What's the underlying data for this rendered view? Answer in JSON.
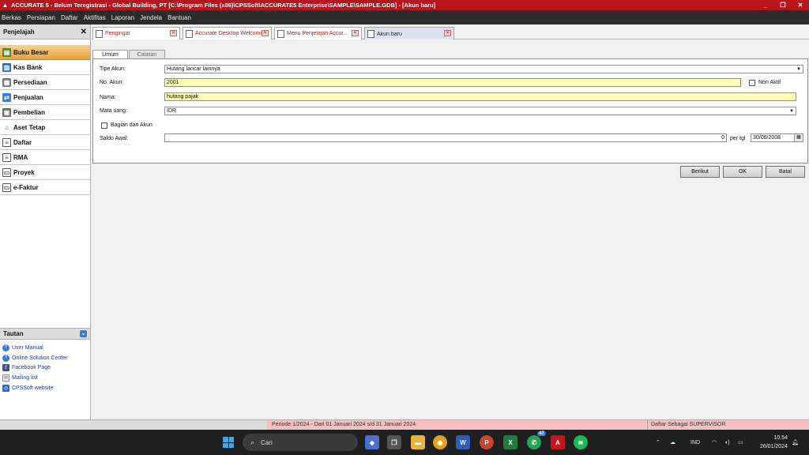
{
  "window": {
    "title": "ACCURATE 5 - Belum Teregistrasi - Global Building, PT   [C:\\Program Files (x86)\\CPSSoft\\ACCURATE5 Enterprise\\SAMPLE\\SAMPLE.GDB] - [Akun baru]",
    "controls": [
      "_",
      "❐",
      "✕"
    ]
  },
  "menu": [
    "Berkas",
    "Persiapan",
    "Daftar",
    "Aktifitas",
    "Laporan",
    "Jendela",
    "Bantuan"
  ],
  "sidebar": {
    "header": "Penjelajah",
    "items": [
      {
        "label": "Buku Besar"
      },
      {
        "label": "Kas Bank"
      },
      {
        "label": "Persediaan"
      },
      {
        "label": "Penjualan"
      },
      {
        "label": "Pembelian"
      },
      {
        "label": "Aset Tetap"
      },
      {
        "label": "Daftar"
      },
      {
        "label": "RMA"
      },
      {
        "label": "Proyek"
      },
      {
        "label": "e-Faktur"
      }
    ],
    "tautan_header": "Tautan",
    "links": [
      "User Manual",
      "Online Solution Center",
      "Facebook Page",
      "Mailing list",
      "CPSSoft website"
    ]
  },
  "tabs": [
    {
      "label": "Pengingat"
    },
    {
      "label": "Accurate Desktop Welcome..."
    },
    {
      "label": "Menu Penjelajah Accur..."
    },
    {
      "label": "Akun baru"
    }
  ],
  "form": {
    "subtabs": [
      "Umum",
      "Catatan"
    ],
    "tipe_akun_label": "Tipe Akun:",
    "tipe_akun_value": "Hutang lancar lainnya",
    "no_akun_label": "No. Akun:",
    "no_akun_value": "2001",
    "non_aktif_label": "Non Aktif",
    "nama_label": "Nama:",
    "nama_value": "hutang pajak",
    "mata_uang_label": "Mata uang:",
    "mata_uang_value": "IDR",
    "bagian_label": "Bagian dari Akun",
    "saldo_label": "Saldo Awal:",
    "saldo_value": "0",
    "per_tgl_label": "per tgl",
    "tanggal_value": "30/06/2008"
  },
  "buttons": {
    "next": "Berikut",
    "ok": "OK",
    "cancel": "Batal"
  },
  "status": {
    "periode": "Periode 1/2024 - Dari 01 Januari 2024 s/d 31 Januari 2024",
    "user": "Daftar Sebagai SUPERVISOR"
  },
  "taskbar": {
    "search_placeholder": "Cari",
    "whatsapp_badge": "47",
    "language": "IND",
    "time": "10.54",
    "date": "26/01/2024"
  }
}
